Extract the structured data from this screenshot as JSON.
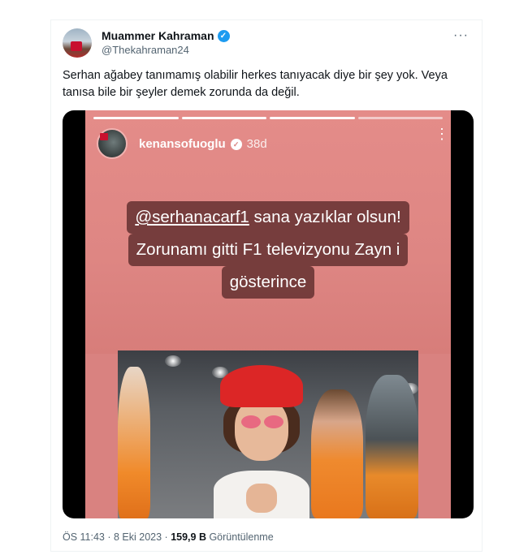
{
  "tweet": {
    "author_name": "Muammer Kahraman",
    "author_handle": "@Thekahraman24",
    "verified_icon": "verified-badge-icon",
    "more_label": "···",
    "text": "Serhan ağabey tanımamış olabilir herkes tanıyacak diye bir şey yok. Veya tanısa bile bir şeyler demek zorunda da değil.",
    "footer": {
      "time": "ÖS 11:43",
      "sep1": " · ",
      "date": "8 Eki 2023",
      "sep2": " · ",
      "views_count": "159,9 B",
      "views_label": "Görüntülenme"
    }
  },
  "story": {
    "username": "kenansofuoglu",
    "time": "38d",
    "more_label": "⋮",
    "caption": {
      "mention": "@serhanacarf1",
      "line1_rest": " sana yazıklar olsun!",
      "line2": "Zorunamı gitti  F1 televizyonu Zayn i",
      "line3": "gösterince"
    }
  },
  "colors": {
    "verified_blue": "#1d9bf0",
    "story_pink": "#de8683",
    "caption_bg": "#5f2d2d"
  }
}
